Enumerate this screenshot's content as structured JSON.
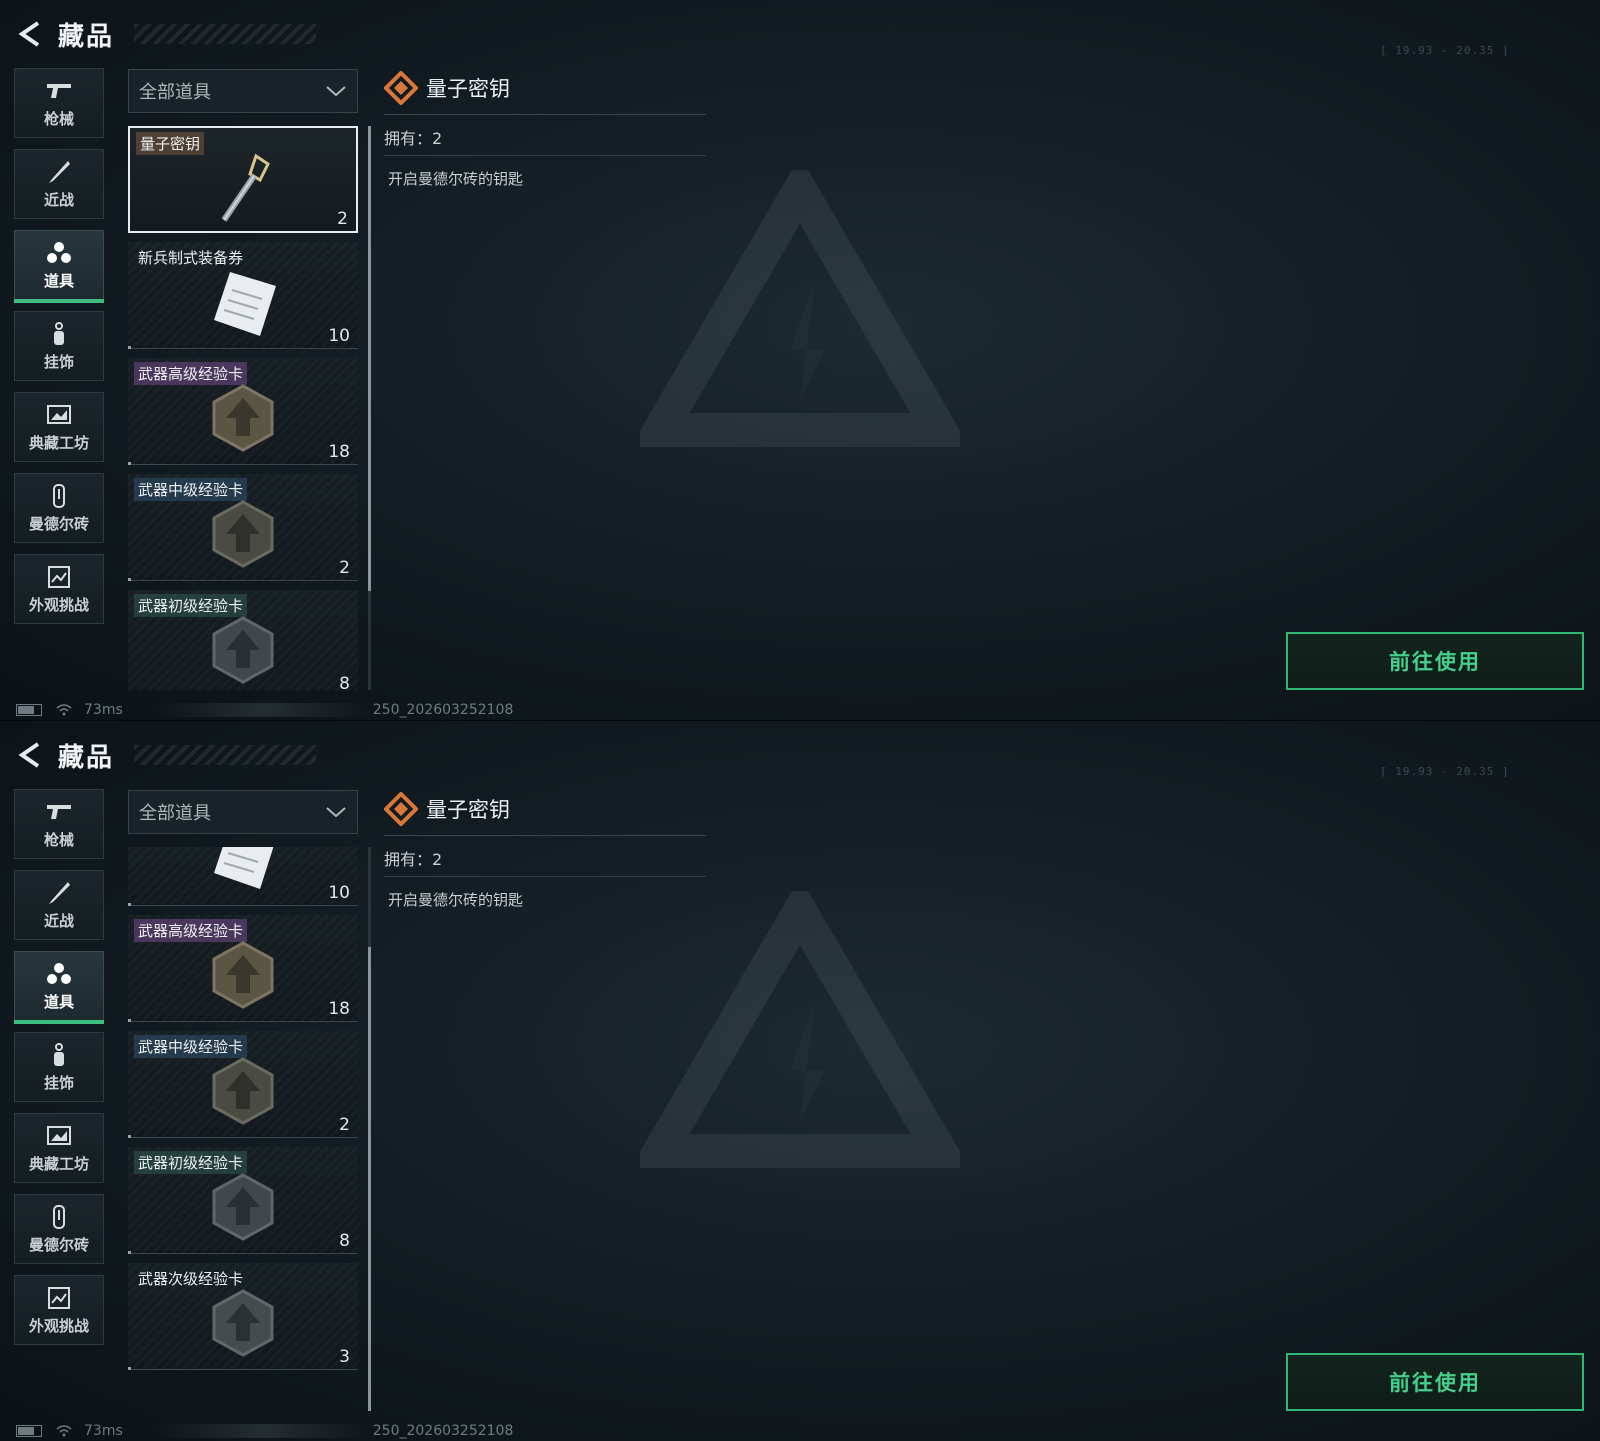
{
  "header": {
    "title": "藏品"
  },
  "sidebar": {
    "items": [
      {
        "label": "枪械",
        "icon": "gun-icon"
      },
      {
        "label": "近战",
        "icon": "knife-icon"
      },
      {
        "label": "道具",
        "icon": "items-icon",
        "active": true
      },
      {
        "label": "挂饰",
        "icon": "charm-icon"
      },
      {
        "label": "典藏工坊",
        "icon": "workshop-icon"
      },
      {
        "label": "曼德尔砖",
        "icon": "brick-icon"
      },
      {
        "label": "外观挑战",
        "icon": "challenge-icon"
      }
    ]
  },
  "filter": {
    "selected": "全部道具"
  },
  "panel1": {
    "items": [
      {
        "name": "量子密钥",
        "count": "2",
        "selected": true
      },
      {
        "name": "新兵制式装备券",
        "count": "10"
      },
      {
        "name": "武器高级经验卡",
        "count": "18"
      },
      {
        "name": "武器中级经验卡",
        "count": "2"
      },
      {
        "name": "武器初级经验卡",
        "count": "8"
      }
    ]
  },
  "panel2": {
    "items": [
      {
        "name": "",
        "count": "10"
      },
      {
        "name": "武器高级经验卡",
        "count": "18"
      },
      {
        "name": "武器中级经验卡",
        "count": "2"
      },
      {
        "name": "武器初级经验卡",
        "count": "8"
      },
      {
        "name": "武器次级经验卡",
        "count": "3"
      }
    ]
  },
  "detail": {
    "name": "量子密钥",
    "owned": "拥有：2",
    "description": "开启曼德尔砖的钥匙"
  },
  "action": {
    "use_label": "前往使用"
  },
  "status": {
    "ping": "73ms",
    "build": "250_202603252108"
  },
  "hud": {
    "coords": "[ 19.93 - 20.35 ]"
  },
  "colors": {
    "accent": "#44d08a",
    "detail_icon": "#d9783a",
    "active_bar": "#3fbf7f"
  }
}
